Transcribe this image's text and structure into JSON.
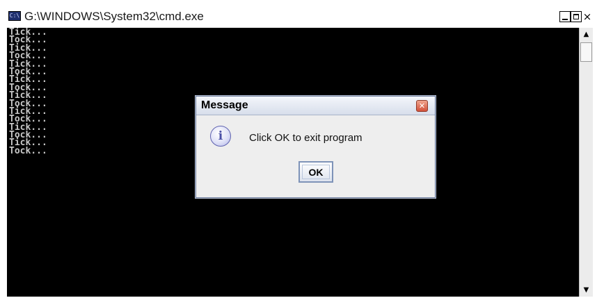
{
  "window": {
    "title": "G:\\WINDOWS\\System32\\cmd.exe",
    "icon": "cmd-icon",
    "controls": {
      "minimize": "minimize-icon",
      "maximize": "maximize-icon",
      "close": "×"
    }
  },
  "console": {
    "background": "#000000",
    "text_color": "#c8c8c8",
    "lines": [
      "Tick...",
      "Tock...",
      "Tick...",
      "Tock...",
      "Tick...",
      "Tock...",
      "Tick...",
      "Tock...",
      "Tick...",
      "Tock...",
      "Tick...",
      "Tock...",
      "Tick...",
      "Tock...",
      "Tick...",
      "Tock..."
    ]
  },
  "scrollbar": {
    "up_arrow": "▲",
    "down_arrow": "▼"
  },
  "dialog": {
    "title": "Message",
    "close_label": "✕",
    "icon": "info-icon",
    "icon_glyph": "i",
    "message": "Click OK to exit program",
    "ok_label": "OK"
  }
}
